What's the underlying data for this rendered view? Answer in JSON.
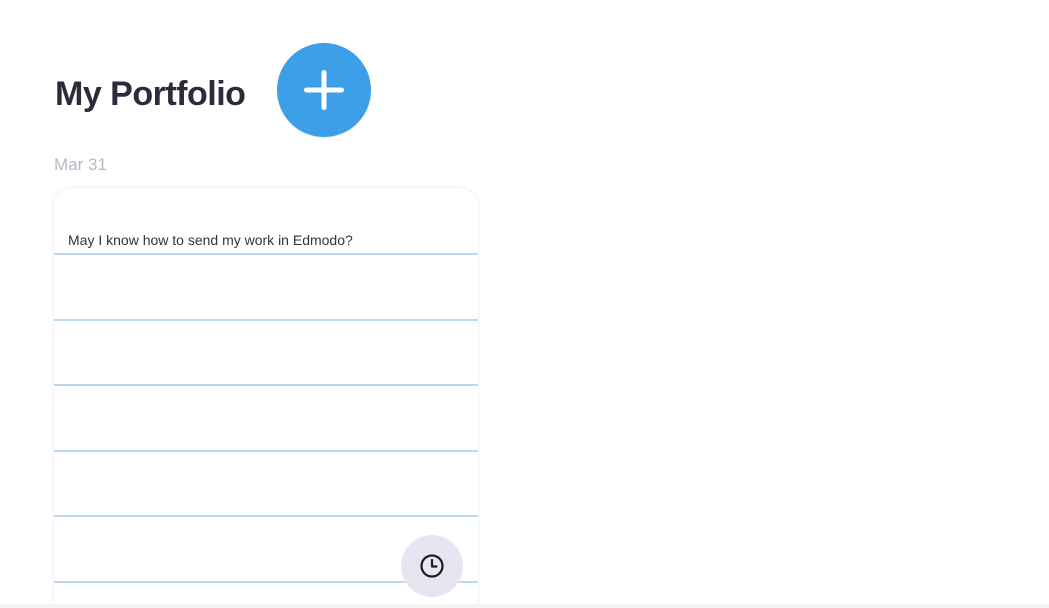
{
  "header": {
    "title": "My Portfolio",
    "add_button_icon": "plus-icon",
    "accent_color": "#3d9fe8"
  },
  "portfolio": {
    "date": "Mar 31",
    "note": {
      "text": "May I know how to send my work in Edmodo?",
      "history_button_icon": "clock-icon"
    }
  }
}
